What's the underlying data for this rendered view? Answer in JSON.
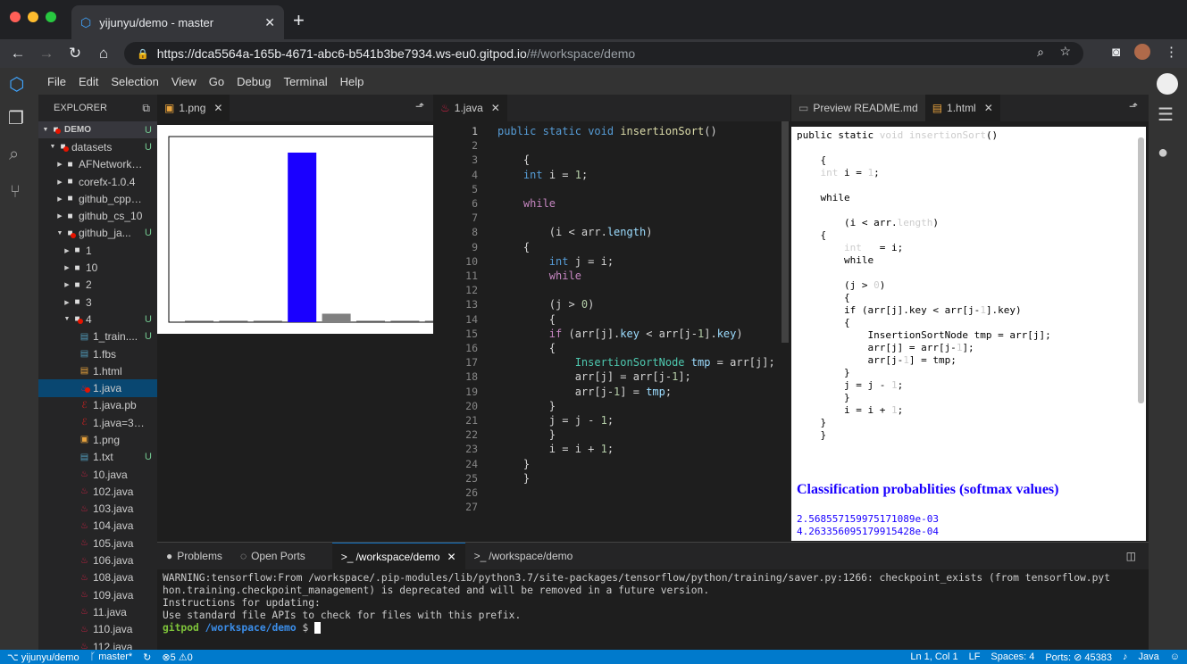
{
  "browser": {
    "tab_title": "yijunyu/demo - master",
    "url_host": "https://dca5564a-165b-4671-abc6-b541b3be7934.ws-eu0.gitpod.io",
    "url_path": "/#/workspace/demo",
    "colors": {
      "close": "#ff5f57",
      "minimize": "#febc2e",
      "maximize": "#28c840"
    }
  },
  "menu": [
    "File",
    "Edit",
    "Selection",
    "View",
    "Go",
    "Debug",
    "Terminal",
    "Help"
  ],
  "explorer": {
    "title": "EXPLORER",
    "root": "DEMO",
    "root_status": "U",
    "rows": [
      {
        "name": "datasets",
        "status": "U",
        "icon": "folder-icon",
        "arrow": "down",
        "indent": 1,
        "dot": true
      },
      {
        "name": "AFNetworkin...",
        "status": "",
        "icon": "folder-icon",
        "arrow": "right",
        "indent": 2
      },
      {
        "name": "corefx-1.0.4",
        "status": "",
        "icon": "folder-icon",
        "arrow": "right",
        "indent": 2
      },
      {
        "name": "github_cpp_10",
        "status": "",
        "icon": "folder-icon",
        "arrow": "right",
        "indent": 2
      },
      {
        "name": "github_cs_10",
        "status": "",
        "icon": "folder-icon",
        "arrow": "right",
        "indent": 2
      },
      {
        "name": "github_ja...",
        "status": "U",
        "icon": "folder-icon",
        "arrow": "down",
        "indent": 2,
        "dot": true
      },
      {
        "name": "1",
        "status": "",
        "icon": "folder-icon",
        "arrow": "right",
        "indent": 3
      },
      {
        "name": "10",
        "status": "",
        "icon": "folder-icon",
        "arrow": "right",
        "indent": 3
      },
      {
        "name": "2",
        "status": "",
        "icon": "folder-icon",
        "arrow": "right",
        "indent": 3
      },
      {
        "name": "3",
        "status": "",
        "icon": "folder-icon",
        "arrow": "right",
        "indent": 3
      },
      {
        "name": "4",
        "status": "U",
        "icon": "folder-icon",
        "arrow": "down",
        "indent": 3,
        "dot": true
      },
      {
        "name": "1_train....",
        "status": "U",
        "icon": "file-icon",
        "arrow": "",
        "indent": 4
      },
      {
        "name": "1.fbs",
        "status": "",
        "icon": "file-icon",
        "arrow": "",
        "indent": 4
      },
      {
        "name": "1.html",
        "status": "",
        "icon": "html-icon",
        "arrow": "",
        "indent": 4
      },
      {
        "name": "1.java",
        "status": "",
        "icon": "java-icon",
        "arrow": "",
        "indent": 4,
        "selected": true,
        "dot": true
      },
      {
        "name": "1.java.pb",
        "status": "",
        "icon": "pb-icon",
        "arrow": "",
        "indent": 4
      },
      {
        "name": "1.java=3.j...",
        "status": "",
        "icon": "pb-icon",
        "arrow": "",
        "indent": 4
      },
      {
        "name": "1.png",
        "status": "",
        "icon": "image-icon",
        "arrow": "",
        "indent": 4
      },
      {
        "name": "1.txt",
        "status": "U",
        "icon": "file-icon",
        "arrow": "",
        "indent": 4
      },
      {
        "name": "10.java",
        "status": "",
        "icon": "java-icon",
        "arrow": "",
        "indent": 4
      },
      {
        "name": "102.java",
        "status": "",
        "icon": "java-icon",
        "arrow": "",
        "indent": 4
      },
      {
        "name": "103.java",
        "status": "",
        "icon": "java-icon",
        "arrow": "",
        "indent": 4
      },
      {
        "name": "104.java",
        "status": "",
        "icon": "java-icon",
        "arrow": "",
        "indent": 4
      },
      {
        "name": "105.java",
        "status": "",
        "icon": "java-icon",
        "arrow": "",
        "indent": 4
      },
      {
        "name": "106.java",
        "status": "",
        "icon": "java-icon",
        "arrow": "",
        "indent": 4
      },
      {
        "name": "108.java",
        "status": "",
        "icon": "java-icon",
        "arrow": "",
        "indent": 4
      },
      {
        "name": "109.java",
        "status": "",
        "icon": "java-icon",
        "arrow": "",
        "indent": 4
      },
      {
        "name": "11.java",
        "status": "",
        "icon": "java-icon",
        "arrow": "",
        "indent": 4
      },
      {
        "name": "110.java",
        "status": "",
        "icon": "java-icon",
        "arrow": "",
        "indent": 4
      },
      {
        "name": "112.java",
        "status": "",
        "icon": "java-icon",
        "arrow": "",
        "indent": 4
      }
    ]
  },
  "tabs": {
    "image": "1.png",
    "java": "1.java",
    "preview": "Preview README.md",
    "html": "1.html"
  },
  "bar_image": {
    "values": [
      0.0,
      0.0,
      0.0,
      1.0,
      0.05,
      0.0,
      0.0,
      0.0
    ],
    "colors": {
      "main": "#1a00ff",
      "other": "#808080"
    }
  },
  "code": [
    "public static void insertionSort()",
    "",
    "    {",
    "    int i = 1;",
    "",
    "    while",
    "",
    "        (i < arr.length)",
    "    {",
    "        int j = i;",
    "        while",
    "",
    "        (j > 0)",
    "        {",
    "        if (arr[j].key < arr[j-1].key)",
    "        {",
    "            InsertionSortNode tmp = arr[j];",
    "            arr[j] = arr[j-1];",
    "            arr[j-1] = tmp;",
    "        }",
    "        j = j - 1;",
    "        }",
    "        i = i + 1;",
    "    }",
    "    }",
    "",
    ""
  ],
  "preview": {
    "lines": [
      "public static void insertionSort()",
      "",
      "    {",
      "    int i = 1;",
      "",
      "    while",
      "",
      "        (i < arr.length)",
      "    {",
      "        int   = i;",
      "        while",
      "",
      "        (j > 0)",
      "        {",
      "        if (arr[j].key < arr[j-1].key)",
      "        {",
      "            InsertionSortNode tmp = arr[j];",
      "            arr[j] = arr[j-1];",
      "            arr[j-1] = tmp;",
      "        }",
      "        j = j - 1;",
      "        }",
      "        i = i + 1;",
      "    }",
      "    }"
    ],
    "heading": "Classification probablities (softmax values)",
    "values": [
      "2.568557159975171089e-03",
      "4.263356095179915428e-04"
    ]
  },
  "panel": {
    "tabs": [
      "Problems",
      "Open Ports",
      "/workspace/demo",
      "/workspace/demo"
    ],
    "terminal": [
      "WARNING:tensorflow:From /workspace/.pip-modules/lib/python3.7/site-packages/tensorflow/python/training/saver.py:1266: checkpoint_exists (from tensorflow.pyt",
      "hon.training.checkpoint_management) is deprecated and will be removed in a future version.",
      "Instructions for updating:",
      "Use standard file APIs to check for files with this prefix."
    ],
    "prompt_user": "gitpod",
    "prompt_path": "/workspace/demo",
    "prompt_sym": "$"
  },
  "status": {
    "repo": "yijunyu/demo",
    "branch": "master*",
    "problems": "5",
    "warnings": "0",
    "position": "Ln 1, Col 1",
    "eol": "LF",
    "spaces": "Spaces: 4",
    "ports": "Ports:",
    "port_num": "45383",
    "lang": "Java"
  }
}
